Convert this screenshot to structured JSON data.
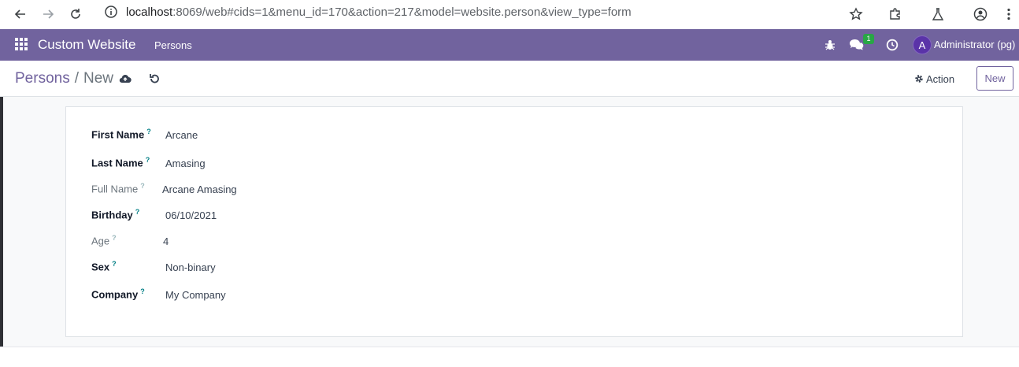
{
  "browser": {
    "url_host": "localhost",
    "url_rest": ":8069/web#cids=1&menu_id=170&action=217&model=website.person&view_type=form"
  },
  "navbar": {
    "app_name": "Custom Website",
    "menu_persons": "Persons",
    "message_count": "1",
    "avatar_letter": "A",
    "user_name": "Administrator (pg)",
    "color": "#71639e"
  },
  "control_panel": {
    "breadcrumb_parent": "Persons",
    "breadcrumb_separator": "/",
    "breadcrumb_current": "New",
    "action_label": "Action",
    "new_label": "New"
  },
  "form": {
    "fields": [
      {
        "label": "First Name",
        "value": "Arcane",
        "style": "required"
      },
      {
        "label": "Last Name",
        "value": "Amasing",
        "style": "required"
      },
      {
        "label": "Full Name",
        "value": "Arcane Amasing",
        "style": "readonly"
      },
      {
        "label": "Birthday",
        "value": "06/10/2021",
        "style": "required"
      },
      {
        "label": "Age",
        "value": "4",
        "style": "readonly"
      },
      {
        "label": "Sex",
        "value": "Non-binary",
        "style": "required"
      },
      {
        "label": "Company",
        "value": "My Company",
        "style": "required"
      }
    ],
    "help_mark": "?"
  }
}
